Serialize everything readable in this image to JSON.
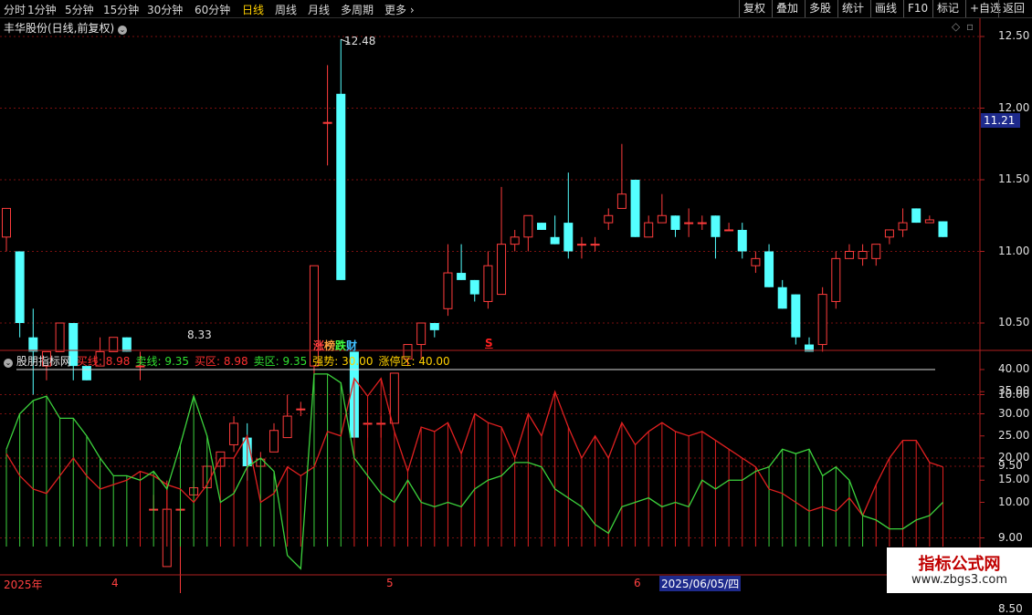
{
  "toolbar": {
    "periods": [
      "分时",
      "1分钟",
      "5分钟",
      "15分钟",
      "30分钟",
      "60分钟",
      "日线",
      "周线",
      "月线",
      "多周期",
      "更多"
    ],
    "active_period": "日线",
    "right_buttons": [
      "复权",
      "叠加",
      "多股",
      "统计",
      "画线",
      "F10",
      "+自选",
      "返回"
    ],
    "right_extra": "标记"
  },
  "stock": {
    "title": "丰华股份(日线,前复权)"
  },
  "price_axis": {
    "ticks": [
      "12.50",
      "12.00",
      "11.50",
      "11.00",
      "10.50",
      "10.00",
      "9.50",
      "9.00",
      "8.50"
    ],
    "current": "11.21"
  },
  "annotations": {
    "high": "12.48",
    "low": "8.33",
    "board_zhang": "涨",
    "board_bang": "榜",
    "board_die": "跌",
    "board_cai": "财",
    "signal": "S"
  },
  "indicator": {
    "name": "股朋指标网",
    "buy_line_label": "买线:",
    "buy_line": "8.98",
    "sell_line_label": "卖线:",
    "sell_line": "9.35",
    "buy_zone_label": "买区:",
    "buy_zone": "8.98",
    "sell_zone_label": "卖区:",
    "sell_zone": "9.35",
    "strong_label": "强势:",
    "strong": "30.00",
    "limit_label": "涨停区:",
    "limit": "40.00",
    "ticks": [
      "40.00",
      "35.00",
      "30.00",
      "25.00",
      "20.00",
      "15.00",
      "10.00"
    ]
  },
  "date_axis": {
    "labels": [
      "2025年",
      "4",
      "5",
      "6"
    ],
    "cursor_date": "2025/06/05/四"
  },
  "watermark": {
    "line1": "指标公式网",
    "line2": "www.zbgs3.com"
  },
  "colors": {
    "up": "#ff3c3c",
    "down": "#54ffff",
    "grid": "#7a1010",
    "sell_line": "#3cd23c",
    "buy_line": "#e02020",
    "highlight": "#ffd000"
  },
  "chart_data": {
    "type": "candlestick",
    "ohlc": [
      [
        11.1,
        11.3,
        11.0,
        11.3
      ],
      [
        11.0,
        11.0,
        10.4,
        10.5
      ],
      [
        10.4,
        10.6,
        10.0,
        10.3
      ],
      [
        10.2,
        10.3,
        10.1,
        10.3
      ],
      [
        10.3,
        10.5,
        10.3,
        10.5
      ],
      [
        10.5,
        10.5,
        10.1,
        10.2
      ],
      [
        10.2,
        10.2,
        10.1,
        10.1
      ],
      [
        10.2,
        10.4,
        10.2,
        10.3
      ],
      [
        10.3,
        10.4,
        10.3,
        10.4
      ],
      [
        10.4,
        10.4,
        10.3,
        10.3
      ],
      [
        10.2,
        10.3,
        10.1,
        10.2
      ],
      [
        9.2,
        9.3,
        9.2,
        9.2
      ],
      [
        8.8,
        9.4,
        8.8,
        9.2
      ],
      [
        9.2,
        9.2,
        8.33,
        9.2
      ],
      [
        9.3,
        9.4,
        9.3,
        9.35
      ],
      [
        9.35,
        9.5,
        9.35,
        9.5
      ],
      [
        9.5,
        9.6,
        9.5,
        9.6
      ],
      [
        9.65,
        9.85,
        9.6,
        9.8
      ],
      [
        9.7,
        9.8,
        9.4,
        9.5
      ],
      [
        9.5,
        9.6,
        9.5,
        9.55
      ],
      [
        9.6,
        9.8,
        9.6,
        9.75
      ],
      [
        9.7,
        10.0,
        9.7,
        9.85
      ],
      [
        9.9,
        9.95,
        9.85,
        9.9
      ],
      [
        10.2,
        10.9,
        10.1,
        10.9
      ],
      [
        11.9,
        12.3,
        11.6,
        11.9
      ],
      [
        12.1,
        12.48,
        10.8,
        10.8
      ],
      [
        10.3,
        10.3,
        9.7,
        9.7
      ],
      [
        9.8,
        9.85,
        9.7,
        9.8
      ],
      [
        9.8,
        9.85,
        9.7,
        9.8
      ],
      [
        9.8,
        10.15,
        9.8,
        10.15
      ],
      [
        10.25,
        10.35,
        10.2,
        10.35
      ],
      [
        10.35,
        10.5,
        10.25,
        10.5
      ],
      [
        10.5,
        10.5,
        10.4,
        10.45
      ],
      [
        10.6,
        11.05,
        10.55,
        10.85
      ],
      [
        10.85,
        11.05,
        10.8,
        10.8
      ],
      [
        10.8,
        10.8,
        10.65,
        10.7
      ],
      [
        10.65,
        11.0,
        10.6,
        10.9
      ],
      [
        10.7,
        11.45,
        10.7,
        11.05
      ],
      [
        11.05,
        11.15,
        11.0,
        11.1
      ],
      [
        11.1,
        11.25,
        11.0,
        11.25
      ],
      [
        11.2,
        11.2,
        11.15,
        11.15
      ],
      [
        11.1,
        11.25,
        11.05,
        11.05
      ],
      [
        11.2,
        11.55,
        10.95,
        11.0
      ],
      [
        11.05,
        11.1,
        10.95,
        11.05
      ],
      [
        11.05,
        11.1,
        11.0,
        11.05
      ],
      [
        11.2,
        11.3,
        11.15,
        11.25
      ],
      [
        11.3,
        11.75,
        11.3,
        11.4
      ],
      [
        11.5,
        11.5,
        11.1,
        11.1
      ],
      [
        11.1,
        11.25,
        11.1,
        11.2
      ],
      [
        11.2,
        11.4,
        11.2,
        11.25
      ],
      [
        11.25,
        11.25,
        11.1,
        11.15
      ],
      [
        11.2,
        11.3,
        11.1,
        11.2
      ],
      [
        11.2,
        11.25,
        11.15,
        11.2
      ],
      [
        11.25,
        11.25,
        10.95,
        11.1
      ],
      [
        11.15,
        11.2,
        11.15,
        11.15
      ],
      [
        11.15,
        11.2,
        10.95,
        11.0
      ],
      [
        10.9,
        11.0,
        10.85,
        10.95
      ],
      [
        11.0,
        11.05,
        10.75,
        10.75
      ],
      [
        10.75,
        10.8,
        10.6,
        10.6
      ],
      [
        10.7,
        10.7,
        10.35,
        10.4
      ],
      [
        10.35,
        10.4,
        10.3,
        10.3
      ],
      [
        10.35,
        10.75,
        10.3,
        10.7
      ],
      [
        10.65,
        11.0,
        10.6,
        10.95
      ],
      [
        10.95,
        11.05,
        10.95,
        11.0
      ],
      [
        10.95,
        11.05,
        10.9,
        11.0
      ],
      [
        10.95,
        11.05,
        10.9,
        11.05
      ],
      [
        11.1,
        11.15,
        11.05,
        11.15
      ],
      [
        11.15,
        11.3,
        11.1,
        11.2
      ],
      [
        11.3,
        11.3,
        11.2,
        11.2
      ],
      [
        11.2,
        11.25,
        11.2,
        11.22
      ],
      [
        11.21,
        11.21,
        11.1,
        11.1
      ]
    ],
    "buy_line": [
      21,
      16,
      13,
      12,
      16,
      20,
      16,
      13,
      14,
      15,
      17,
      16,
      14,
      13,
      10,
      14,
      20,
      20,
      25,
      10,
      12,
      18,
      16,
      18,
      26,
      25,
      38,
      34,
      38,
      26,
      17,
      27,
      26,
      28,
      21,
      30,
      28,
      27,
      20,
      30,
      25,
      35,
      27,
      20,
      25,
      20,
      28,
      23,
      26,
      28,
      26,
      25,
      26,
      24,
      22,
      20,
      18,
      13,
      12,
      10,
      8,
      9,
      8,
      11,
      7,
      14,
      20,
      24,
      24,
      19,
      18,
      19,
      17,
      15,
      10
    ],
    "sell_line": [
      22,
      30,
      33,
      34,
      29,
      29,
      25,
      20,
      16,
      16,
      15,
      17,
      13,
      23,
      34,
      25,
      10,
      12,
      18,
      20,
      17,
      -2,
      -5,
      39,
      39,
      37,
      20,
      16,
      12,
      10,
      15,
      10,
      9,
      10,
      9,
      13,
      15,
      16,
      19,
      19,
      18,
      13,
      11,
      9,
      5,
      3,
      9,
      10,
      11,
      9,
      10,
      9,
      15,
      13,
      15,
      15,
      17,
      18,
      22,
      21,
      22,
      16,
      18,
      15,
      7,
      6,
      4,
      4,
      6,
      7,
      10
    ],
    "ylim": [
      0,
      42
    ]
  }
}
